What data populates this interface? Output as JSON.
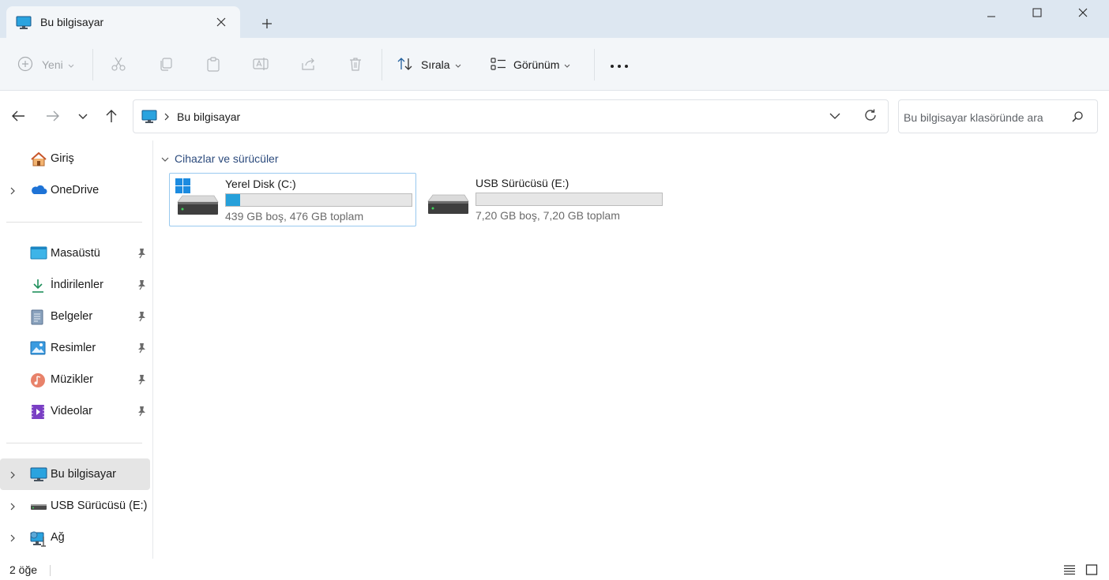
{
  "window": {
    "tab_title": "Bu bilgisayar",
    "new_tab": "+"
  },
  "toolbar": {
    "new_label": "Yeni",
    "sort_label": "Sırala",
    "view_label": "Görünüm",
    "more_label": "•••"
  },
  "address": {
    "crumb": "Bu bilgisayar",
    "search_placeholder": "Bu bilgisayar klasöründe ara"
  },
  "sidebar": {
    "items": [
      {
        "label": "Giriş",
        "icon": "home-icon"
      },
      {
        "label": "OneDrive",
        "icon": "cloud-icon"
      },
      {
        "label": "Masaüstü",
        "icon": "desktop-icon"
      },
      {
        "label": "İndirilenler",
        "icon": "download-icon"
      },
      {
        "label": "Belgeler",
        "icon": "document-icon"
      },
      {
        "label": "Resimler",
        "icon": "pictures-icon"
      },
      {
        "label": "Müzikler",
        "icon": "music-icon"
      },
      {
        "label": "Videolar",
        "icon": "videos-icon"
      },
      {
        "label": "Bu bilgisayar",
        "icon": "pc-icon"
      },
      {
        "label": "USB Sürücüsü (E:)",
        "icon": "usb-drive-icon"
      },
      {
        "label": "Ağ",
        "icon": "network-icon"
      }
    ]
  },
  "content": {
    "group_title": "Cihazlar ve sürücüler",
    "drives": [
      {
        "name": "Yerel Disk (C:)",
        "info": "439 GB boş, 476 GB toplam",
        "used_fraction": 0.078,
        "icon": "system-drive-icon"
      },
      {
        "name": "USB Sürücüsü (E:)",
        "info": "7,20 GB boş, 7,20 GB toplam",
        "used_fraction": 0.0,
        "icon": "usb-drive-icon"
      }
    ]
  },
  "status": {
    "count": "2 öğe"
  },
  "colors": {
    "accent": "#26a0da",
    "titlebar": "#dde7f1",
    "toolbar": "#f3f6f9",
    "selected_item": "#e5e5e5"
  }
}
